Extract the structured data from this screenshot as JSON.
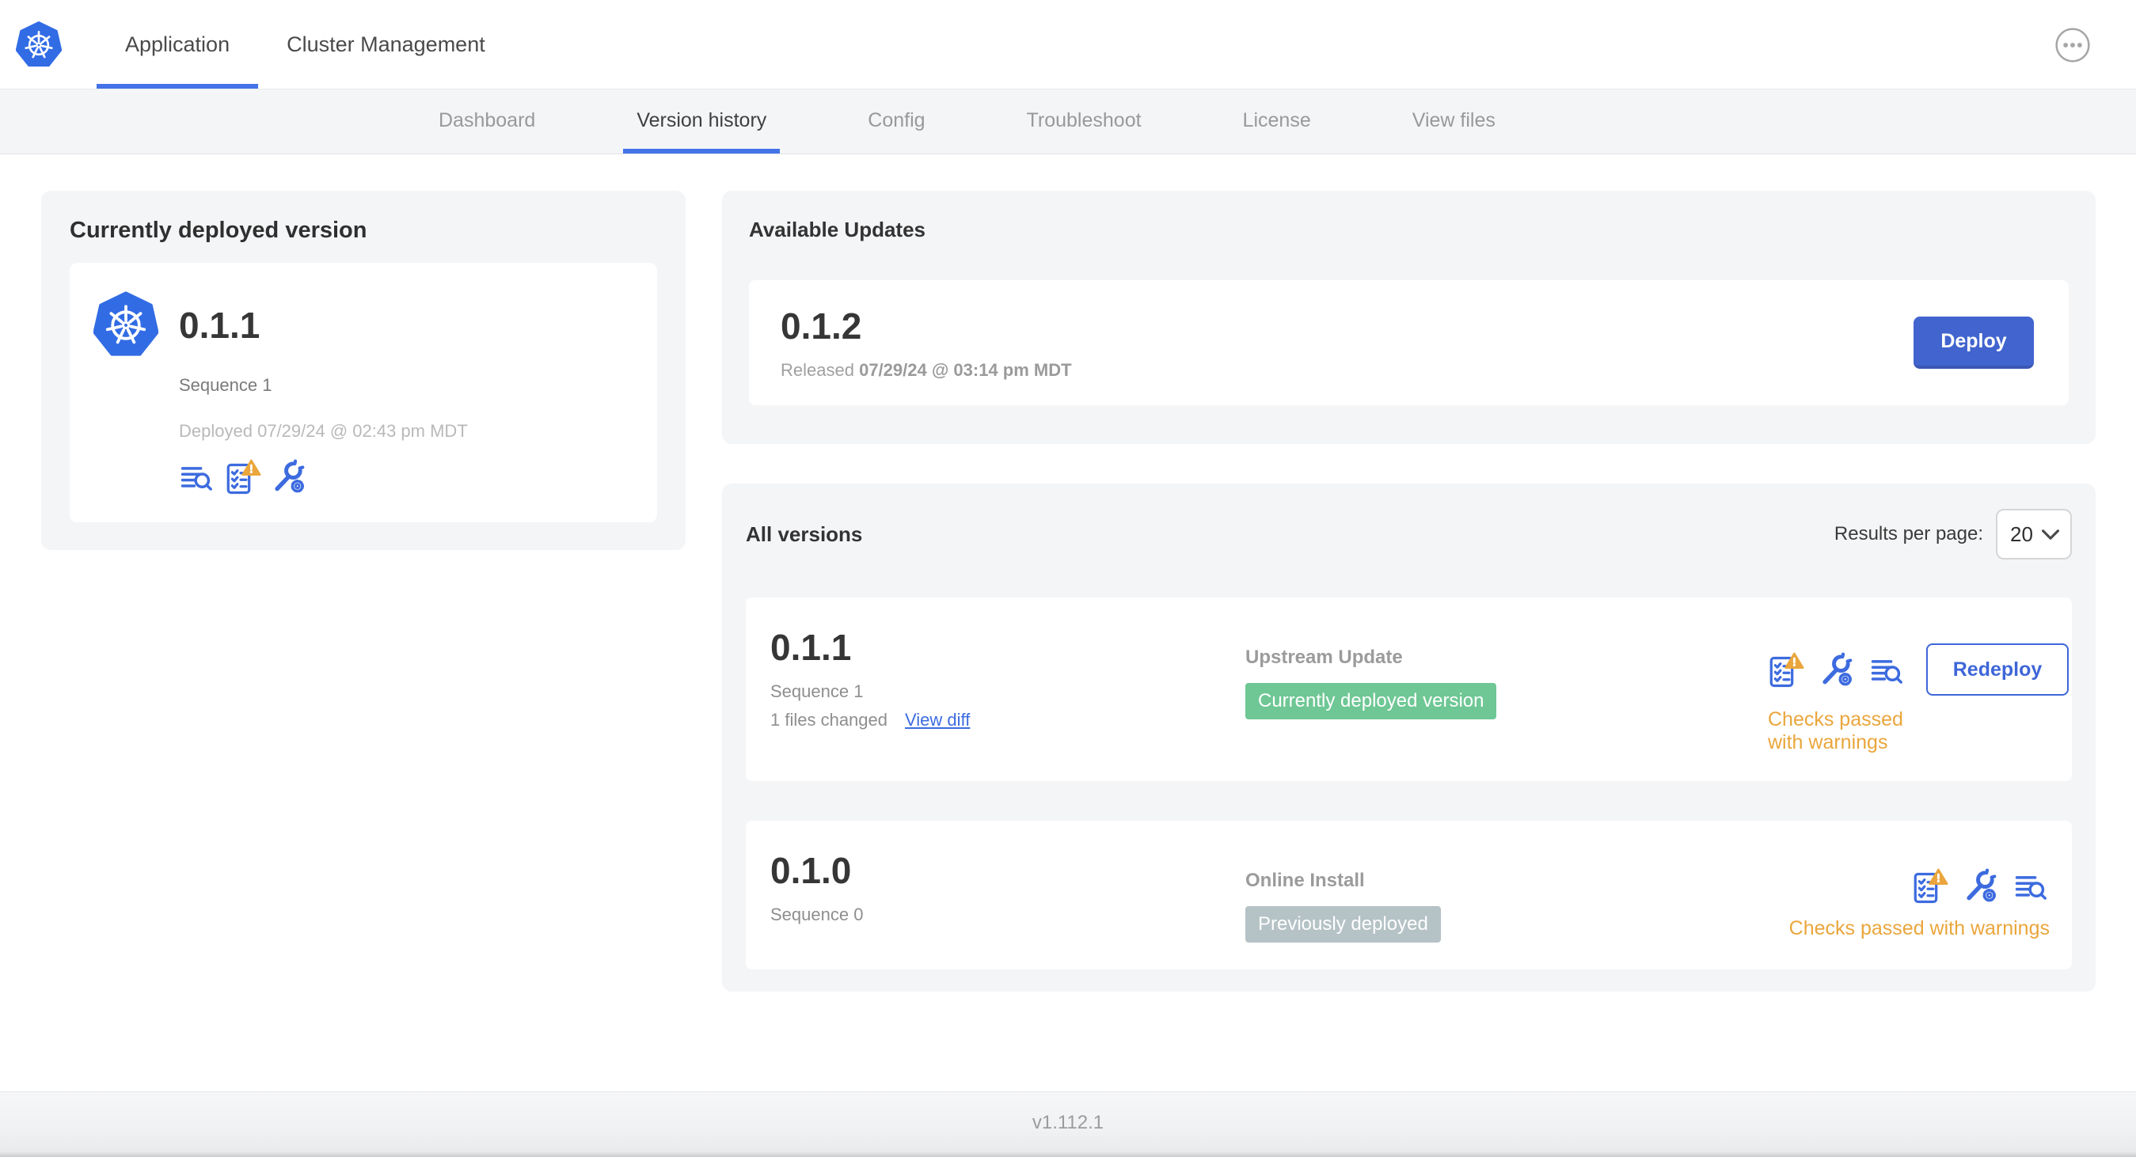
{
  "colors": {
    "accent_blue": "#3E66D8",
    "kubernetes_blue": "#326CE5",
    "success_green": "#6EC794",
    "muted_badge_gray": "#B5C2C6",
    "warning_orange": "#EAA63C"
  },
  "topnav": {
    "tabs": [
      {
        "label": "Application",
        "active": true
      },
      {
        "label": "Cluster Management",
        "active": false
      }
    ],
    "menu_icon": "ellipsis-menu-icon"
  },
  "subnav": {
    "tabs": [
      {
        "label": "Dashboard",
        "active": false
      },
      {
        "label": "Version history",
        "active": true
      },
      {
        "label": "Config",
        "active": false
      },
      {
        "label": "Troubleshoot",
        "active": false
      },
      {
        "label": "License",
        "active": false
      },
      {
        "label": "View files",
        "active": false
      }
    ]
  },
  "currently_deployed": {
    "title": "Currently deployed version",
    "version": "0.1.1",
    "sequence": "Sequence 1",
    "deployed_at": "Deployed 07/29/24 @ 02:43 pm MDT",
    "icons": [
      "log-search-icon",
      "preflight-checklist-warning-icon",
      "wrench-gear-icon"
    ]
  },
  "available_updates": {
    "title": "Available Updates",
    "version": "0.1.2",
    "released_prefix": "Released",
    "released_at": "07/29/24 @ 03:14 pm MDT",
    "deploy_button": "Deploy"
  },
  "all_versions": {
    "title": "All versions",
    "results_per_page_label": "Results per page:",
    "results_per_page_value": "20",
    "rows": [
      {
        "version": "0.1.1",
        "sequence": "Sequence 1",
        "files_changed": "1 files changed",
        "view_diff_link": "View diff",
        "source": "Upstream Update",
        "status_badge": "Currently deployed version",
        "status_badge_color": "green",
        "icons": [
          "preflight-checklist-warning-icon",
          "wrench-gear-icon",
          "log-search-icon"
        ],
        "action_button": "Redeploy",
        "checks_status": "Checks passed with warnings"
      },
      {
        "version": "0.1.0",
        "sequence": "Sequence 0",
        "source": "Online Install",
        "status_badge": "Previously deployed",
        "status_badge_color": "gray",
        "icons": [
          "preflight-checklist-warning-icon",
          "wrench-gear-icon",
          "log-search-icon"
        ],
        "checks_status": "Checks passed with warnings"
      }
    ]
  },
  "footer": {
    "app_version": "v1.112.1"
  }
}
